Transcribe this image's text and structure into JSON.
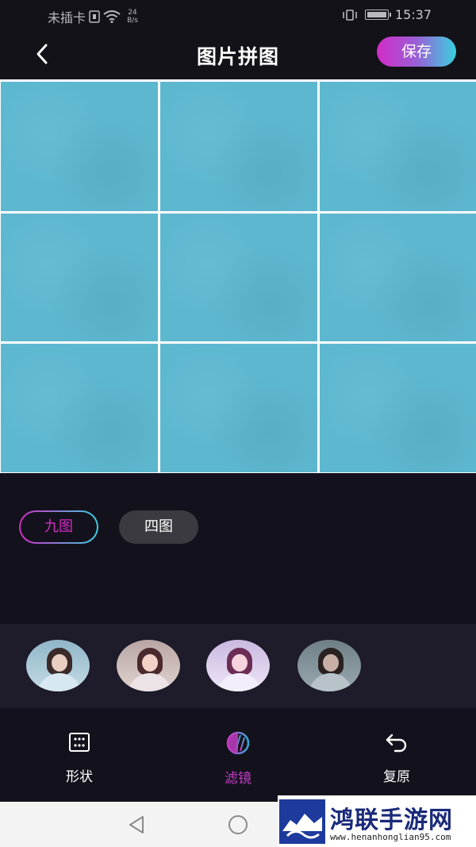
{
  "status_bar": {
    "carrier": "未插卡",
    "net_speed_value": "24",
    "net_speed_unit": "B/s",
    "time": "15:37"
  },
  "header": {
    "title": "图片拼图",
    "save_label": "保存"
  },
  "grid": {
    "rows": 3,
    "cols": 3,
    "cell_color": "#5db8cf"
  },
  "modes": {
    "nine_label": "九图",
    "four_label": "四图",
    "selected": "九图"
  },
  "filters": {
    "thumbnails": [
      {
        "name": "filter-original"
      },
      {
        "name": "filter-warm"
      },
      {
        "name": "filter-pink"
      },
      {
        "name": "filter-dark"
      }
    ]
  },
  "toolbar": {
    "shape_label": "形状",
    "filter_label": "滤镜",
    "reset_label": "复原",
    "active": "滤镜"
  },
  "watermark": {
    "title": "鸿联手游网",
    "url": "www.henanhonglian95.com"
  },
  "colors": {
    "accent_pink": "#d22cc6",
    "accent_cyan": "#3ad0e0",
    "background": "#13121c"
  }
}
